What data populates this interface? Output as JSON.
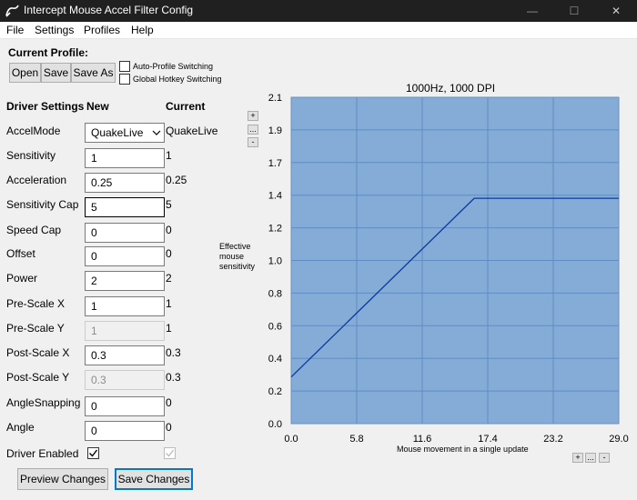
{
  "window": {
    "title": "Intercept Mouse Accel Filter Config",
    "controls": {
      "minimize": "—",
      "maximize": "☐",
      "close": "✕"
    }
  },
  "menu": [
    "File",
    "Settings",
    "Profiles",
    "Help"
  ],
  "profile": {
    "label": "Current Profile:",
    "open": "Open",
    "save": "Save",
    "save_as": "Save As",
    "auto_switch": {
      "label": "Auto-Profile Switching",
      "checked": false
    },
    "hotkey_switch": {
      "label": "Global Hotkey Switching",
      "checked": false
    }
  },
  "headers": {
    "settings": "Driver Settings",
    "new": "New",
    "current": "Current"
  },
  "settings": [
    {
      "label": "AccelMode",
      "kind": "select",
      "new": "QuakeLive",
      "current": "QuakeLive"
    },
    {
      "label": "Sensitivity",
      "kind": "text",
      "new": "1",
      "current": "1"
    },
    {
      "label": "Acceleration",
      "kind": "text",
      "new": "0.25",
      "current": "0.25"
    },
    {
      "label": "Sensitivity Cap",
      "kind": "text",
      "new": "5",
      "current": "5",
      "focused": true
    },
    {
      "label": "Speed Cap",
      "kind": "text",
      "new": "0",
      "current": "0"
    },
    {
      "label": "Offset",
      "kind": "text",
      "new": "0",
      "current": "0"
    },
    {
      "label": "Power",
      "kind": "text",
      "new": "2",
      "current": "2"
    },
    {
      "label": "Pre-Scale X",
      "kind": "text",
      "new": "1",
      "current": "1"
    },
    {
      "label": "Pre-Scale Y",
      "kind": "text",
      "new": "1",
      "current": "1",
      "disabled": true
    },
    {
      "label": "Post-Scale X",
      "kind": "text",
      "new": "0.3",
      "current": "0.3"
    },
    {
      "label": "Post-Scale Y",
      "kind": "text",
      "new": "0.3",
      "current": "0.3",
      "disabled": true
    },
    {
      "label": "AngleSnapping",
      "kind": "text",
      "new": "0",
      "current": "0"
    },
    {
      "label": "Angle",
      "kind": "text",
      "new": "0",
      "current": "0"
    }
  ],
  "driver_enabled": {
    "label": "Driver Enabled",
    "new_checked": true,
    "current_checked": true
  },
  "actions": {
    "preview": "Preview Changes",
    "save": "Save Changes"
  },
  "zoom_y": {
    "plus": "+",
    "dots": "...",
    "minus": "-"
  },
  "zoom_x": {
    "plus": "+",
    "dots": "...",
    "minus": "-"
  },
  "colors": {
    "plot_bg": "#84acd7",
    "grid": "#5f8cc4",
    "curve": "#0a3aa0",
    "titlebar": "#202020"
  },
  "icons": {
    "app": "mouse-app-icon",
    "dropdown": "chevron-down-icon",
    "check": "checkmark-icon"
  },
  "chart_data": {
    "type": "line",
    "title": "1000Hz, 1000 DPI",
    "xlabel": "Mouse movement in a single update",
    "ylabel": "Effective mouse sensitivity",
    "xlim": [
      0,
      29
    ],
    "ylim": [
      0,
      2.1
    ],
    "xticks": [
      "0.0",
      "5.8",
      "11.6",
      "17.4",
      "23.2",
      "29.0"
    ],
    "yticks": [
      "0.0",
      "0.2",
      "0.4",
      "0.6",
      "0.8",
      "1.0",
      "1.2",
      "1.4",
      "1.7",
      "1.9",
      "2.1"
    ],
    "grid": true,
    "series": [
      {
        "x": [
          0,
          16.2,
          29
        ],
        "y": [
          0.3,
          1.45,
          1.45
        ]
      }
    ]
  }
}
